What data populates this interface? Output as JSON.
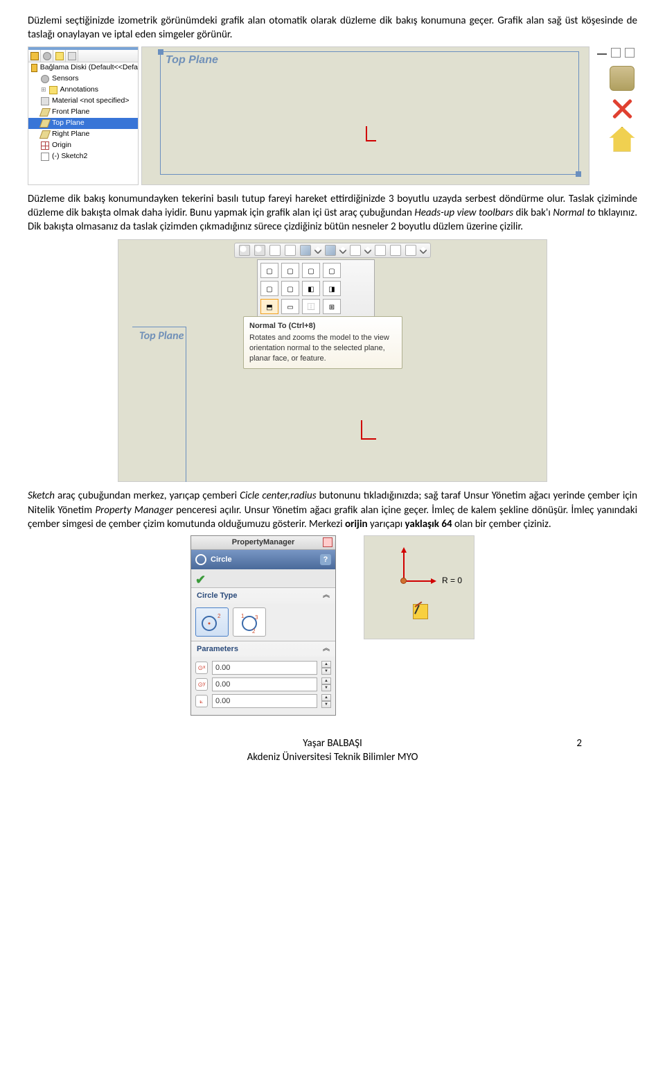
{
  "paragraphs": {
    "p1": "Düzlemi seçtiğinizde izometrik görünümdeki grafik alan otomatik olarak düzleme dik bakış konumuna geçer. Grafik alan sağ üst köşesinde de taslağı onaylayan ve iptal eden simgeler görünür.",
    "p2_a": "Düzleme dik bakış konumundayken tekerini basılı tutup fareyi hareket ettirdiğinizde 3 boyutlu uzayda serbest döndürme olur. Taslak çiziminde düzleme dik bakışta olmak daha iyidir. Bunu yapmak için grafik alan içi üst araç çubuğundan ",
    "p2_i": "Heads-up view toolbars",
    "p2_b": " dik bak'ı ",
    "p2_i2": "Normal to",
    "p2_c": " tıklayınız. Dik bakışta olmasanız da taslak çizimden çıkmadığınız sürece çizdiğiniz bütün nesneler 2 boyutlu düzlem üzerine çizilir.",
    "p3_a": "Sketch",
    "p3_b": " araç çubuğundan merkez, yarıçap çemberi ",
    "p3_c": "Cicle center,radius",
    "p3_d": " butonunu tıkladığınızda; sağ taraf Unsur Yönetim ağacı yerinde çember için Nitelik Yönetim ",
    "p3_e": "Property Manager",
    "p3_f": " penceresi açılır. Unsur Yönetim ağacı grafik alan içine geçer. İmleç de kalem şekline dönüşür. İmleç yanındaki çember simgesi de çember çizim komutunda olduğumuzu gösterir. Merkezi ",
    "p3_g": "orijin",
    "p3_h": " yarıçapı ",
    "p3_i": "yaklaşık 64",
    "p3_j": " olan bir çember çiziniz."
  },
  "tree": {
    "root": "Bağlama Diski  (Default<<Defa",
    "items": [
      "Sensors",
      "Annotations",
      "Material <not specified>",
      "Front Plane",
      "Top Plane",
      "Right Plane",
      "Origin",
      "(-) Sketch2"
    ]
  },
  "planeLabel": "Top Plane",
  "tooltip": {
    "title": "Normal To   (Ctrl+8)",
    "body": "Rotates and zooms the model to the view orientation normal to the selected plane, planar face, or feature."
  },
  "pm": {
    "title": "PropertyManager",
    "feature": "Circle",
    "sec1": "Circle Type",
    "sec2": "Parameters",
    "params": [
      "0.00",
      "0.00",
      "0.00"
    ]
  },
  "origin": {
    "rlabel": "R = 0"
  },
  "footer": {
    "author": "Yaşar BALBAŞI",
    "org": "Akdeniz Üniversitesi Teknik Bilimler MYO",
    "page": "2"
  }
}
